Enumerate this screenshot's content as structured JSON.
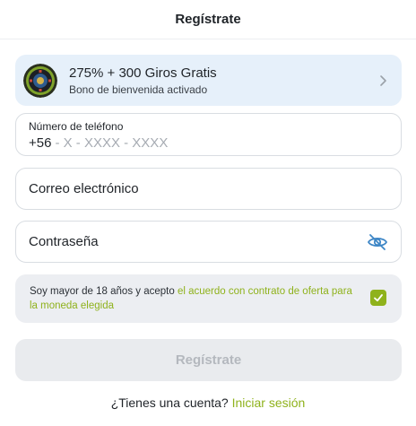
{
  "header": {
    "title": "Regístrate"
  },
  "promo": {
    "icon": "roulette-wheel-icon",
    "title": "275% + 300 Giros Gratis",
    "subtitle": "Bono de bienvenida activado",
    "chevron": "chevron-right-icon"
  },
  "phone": {
    "label": "Número de teléfono",
    "code": "+56",
    "placeholder": "- X - XXXX - XXXX"
  },
  "email": {
    "placeholder": "Correo electrónico"
  },
  "password": {
    "placeholder": "Contraseña",
    "icon": "eye-off-icon"
  },
  "agreement": {
    "text": "Soy mayor de 18 años y acepto ",
    "link": "el acuerdo con contrato de oferta para la moneda elegida",
    "checked": true
  },
  "submit": {
    "label": "Regístrate",
    "enabled": false
  },
  "footer": {
    "question": "¿Tienes una cuenta? ",
    "link": "Iniciar sesión"
  },
  "colors": {
    "accent": "#8fb21c",
    "promo_bg": "#e6f0fa",
    "muted_bg": "#eceef2"
  }
}
